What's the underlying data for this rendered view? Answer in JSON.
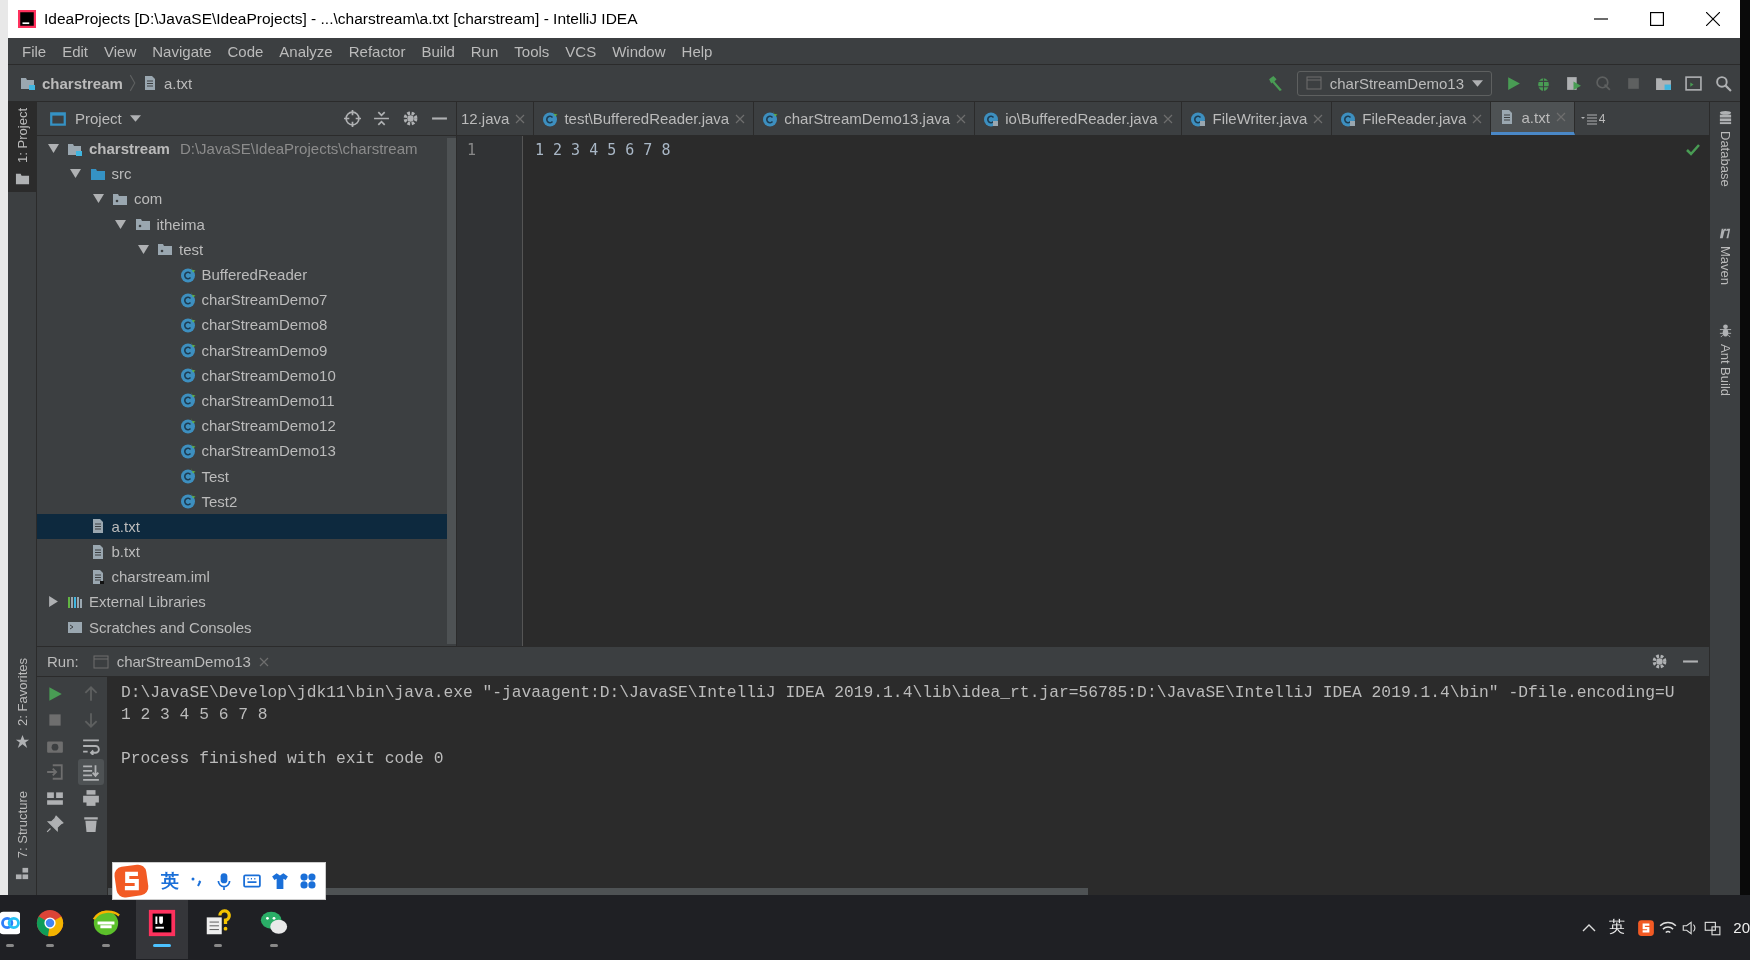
{
  "window": {
    "title": "IdeaProjects [D:\\JavaSE\\IdeaProjects] - ...\\charstream\\a.txt [charstream] - IntelliJ IDEA"
  },
  "menu": [
    "File",
    "Edit",
    "View",
    "Navigate",
    "Code",
    "Analyze",
    "Refactor",
    "Build",
    "Run",
    "Tools",
    "VCS",
    "Window",
    "Help"
  ],
  "breadcrumbs": [
    {
      "label": "charstream",
      "kind": "module"
    },
    {
      "label": "a.txt",
      "kind": "text_file"
    }
  ],
  "toolbar": {
    "run_config": "charStreamDemo13"
  },
  "left_tool_windows": [
    {
      "label": "1: Project",
      "kind": "project",
      "selected": true
    },
    {
      "label": "2: Favorites",
      "kind": "favorites",
      "selected": false
    },
    {
      "label": "7: Structure",
      "kind": "structure",
      "selected": false
    }
  ],
  "right_tool_windows": [
    {
      "label": "Database",
      "kind": "database"
    },
    {
      "label": "Maven",
      "kind": "maven"
    },
    {
      "label": "Ant Build",
      "kind": "ant"
    }
  ],
  "project_panel": {
    "title": "Project"
  },
  "project_tree": [
    {
      "label": "charstream",
      "path": "D:\\JavaSE\\IdeaProjects\\charstream",
      "kind": "module",
      "expanded": true,
      "selected": false,
      "children": [
        {
          "label": "src",
          "kind": "source_folder",
          "expanded": true,
          "selected": false,
          "children": [
            {
              "label": "com",
              "kind": "package",
              "expanded": true,
              "selected": false,
              "children": [
                {
                  "label": "itheima",
                  "kind": "package",
                  "expanded": true,
                  "selected": false,
                  "children": [
                    {
                      "label": "test",
                      "kind": "package",
                      "expanded": true,
                      "selected": false,
                      "children": [
                        {
                          "label": "BufferedReader",
                          "kind": "class",
                          "selected": false
                        },
                        {
                          "label": "charStreamDemo7",
                          "kind": "class",
                          "selected": false
                        },
                        {
                          "label": "charStreamDemo8",
                          "kind": "class",
                          "selected": false
                        },
                        {
                          "label": "charStreamDemo9",
                          "kind": "class",
                          "selected": false
                        },
                        {
                          "label": "charStreamDemo10",
                          "kind": "class",
                          "selected": false
                        },
                        {
                          "label": "charStreamDemo11",
                          "kind": "class",
                          "selected": false
                        },
                        {
                          "label": "charStreamDemo12",
                          "kind": "class",
                          "selected": false
                        },
                        {
                          "label": "charStreamDemo13",
                          "kind": "class",
                          "selected": false
                        },
                        {
                          "label": "Test",
                          "kind": "class",
                          "selected": false
                        },
                        {
                          "label": "Test2",
                          "kind": "class",
                          "selected": false
                        }
                      ]
                    }
                  ]
                }
              ]
            }
          ]
        },
        {
          "label": "a.txt",
          "kind": "text_file",
          "selected": true
        },
        {
          "label": "b.txt",
          "kind": "text_file",
          "selected": false
        },
        {
          "label": "charstream.iml",
          "kind": "iml",
          "selected": false
        }
      ]
    },
    {
      "label": "External Libraries",
      "kind": "libraries",
      "expanded": false,
      "selected": false
    },
    {
      "label": "Scratches and Consoles",
      "kind": "scratches",
      "selected": false
    }
  ],
  "editor": {
    "tabs": [
      {
        "label": "12.java",
        "selected": false
      },
      {
        "label": "test\\BufferedReader.java",
        "kind": "class",
        "selected": false
      },
      {
        "label": "charStreamDemo13.java",
        "kind": "class",
        "selected": false
      },
      {
        "label": "io\\BufferedReader.java",
        "kind": "library_class",
        "selected": false
      },
      {
        "label": "FileWriter.java",
        "kind": "library_class",
        "selected": false
      },
      {
        "label": "FileReader.java",
        "kind": "library_class",
        "selected": false
      },
      {
        "label": "a.txt",
        "kind": "text_file",
        "selected": true
      }
    ],
    "hidden_tab_count": "4",
    "lines": [
      {
        "number": "1",
        "text": "1 2 3 4 5 6 7 8"
      }
    ]
  },
  "run_panel": {
    "label": "Run:",
    "tab": "charStreamDemo13",
    "command": "D:\\JavaSE\\Develop\\jdk11\\bin\\java.exe \"-javaagent:D:\\JavaSE\\IntelliJ IDEA 2019.1.4\\lib\\idea_rt.jar=56785:D:\\JavaSE\\IntelliJ IDEA 2019.1.4\\bin\" -Dfile.encoding=U",
    "program_output": "1 2 3 4 5 6 7 8",
    "exit_message": "Process finished with exit code 0"
  },
  "ime_bar": {
    "mode": "英"
  },
  "taskbar": {
    "apps": [
      {
        "kind": "cloud",
        "selected": false
      },
      {
        "kind": "chrome",
        "selected": false
      },
      {
        "kind": "browser",
        "selected": false
      },
      {
        "kind": "intellij",
        "selected": true
      },
      {
        "kind": "notes",
        "selected": false
      },
      {
        "kind": "chat",
        "selected": false
      }
    ],
    "tray_ime": "英",
    "clock": "20"
  }
}
